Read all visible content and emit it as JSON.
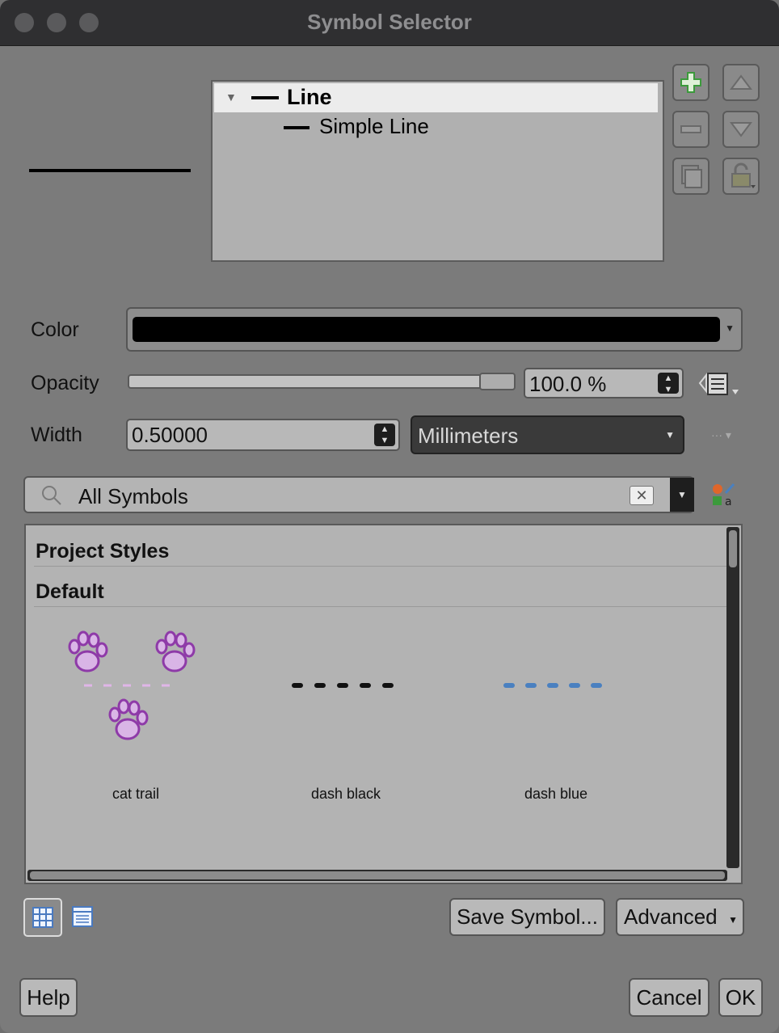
{
  "window": {
    "title": "Symbol Selector"
  },
  "layers_tree": {
    "root_label": "Line",
    "child_label": "Simple Line"
  },
  "properties": {
    "color_label": "Color",
    "color_value": "#000000",
    "opacity_label": "Opacity",
    "opacity_value": "100.0 %",
    "opacity_level": 1.0,
    "width_label": "Width",
    "width_value": "0.50000",
    "unit_value": "Millimeters"
  },
  "search": {
    "value": "All Symbols"
  },
  "library": {
    "sections": [
      "Project Styles",
      "Default"
    ],
    "symbols": [
      {
        "name": "cat trail",
        "icon": "paw-print-trail"
      },
      {
        "name": "dash  black",
        "icon": "dashed-line-black"
      },
      {
        "name": "dash blue",
        "icon": "dashed-line-blue"
      }
    ]
  },
  "buttons": {
    "save_symbol": "Save Symbol...",
    "advanced": "Advanced",
    "help": "Help",
    "cancel": "Cancel",
    "ok": "OK"
  },
  "colors": {
    "accent_green": "#3c9a3c",
    "paw_purple": "#a05ab8",
    "dash_blue": "#4a80c0"
  }
}
